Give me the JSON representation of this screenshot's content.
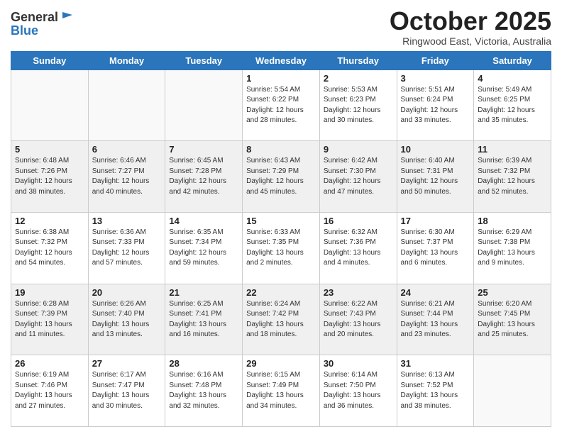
{
  "header": {
    "logo_line1": "General",
    "logo_line2": "Blue",
    "month": "October 2025",
    "location": "Ringwood East, Victoria, Australia"
  },
  "weekdays": [
    "Sunday",
    "Monday",
    "Tuesday",
    "Wednesday",
    "Thursday",
    "Friday",
    "Saturday"
  ],
  "rows": [
    [
      {
        "day": "",
        "info": ""
      },
      {
        "day": "",
        "info": ""
      },
      {
        "day": "",
        "info": ""
      },
      {
        "day": "1",
        "info": "Sunrise: 5:54 AM\nSunset: 6:22 PM\nDaylight: 12 hours\nand 28 minutes."
      },
      {
        "day": "2",
        "info": "Sunrise: 5:53 AM\nSunset: 6:23 PM\nDaylight: 12 hours\nand 30 minutes."
      },
      {
        "day": "3",
        "info": "Sunrise: 5:51 AM\nSunset: 6:24 PM\nDaylight: 12 hours\nand 33 minutes."
      },
      {
        "day": "4",
        "info": "Sunrise: 5:49 AM\nSunset: 6:25 PM\nDaylight: 12 hours\nand 35 minutes."
      }
    ],
    [
      {
        "day": "5",
        "info": "Sunrise: 6:48 AM\nSunset: 7:26 PM\nDaylight: 12 hours\nand 38 minutes."
      },
      {
        "day": "6",
        "info": "Sunrise: 6:46 AM\nSunset: 7:27 PM\nDaylight: 12 hours\nand 40 minutes."
      },
      {
        "day": "7",
        "info": "Sunrise: 6:45 AM\nSunset: 7:28 PM\nDaylight: 12 hours\nand 42 minutes."
      },
      {
        "day": "8",
        "info": "Sunrise: 6:43 AM\nSunset: 7:29 PM\nDaylight: 12 hours\nand 45 minutes."
      },
      {
        "day": "9",
        "info": "Sunrise: 6:42 AM\nSunset: 7:30 PM\nDaylight: 12 hours\nand 47 minutes."
      },
      {
        "day": "10",
        "info": "Sunrise: 6:40 AM\nSunset: 7:31 PM\nDaylight: 12 hours\nand 50 minutes."
      },
      {
        "day": "11",
        "info": "Sunrise: 6:39 AM\nSunset: 7:32 PM\nDaylight: 12 hours\nand 52 minutes."
      }
    ],
    [
      {
        "day": "12",
        "info": "Sunrise: 6:38 AM\nSunset: 7:32 PM\nDaylight: 12 hours\nand 54 minutes."
      },
      {
        "day": "13",
        "info": "Sunrise: 6:36 AM\nSunset: 7:33 PM\nDaylight: 12 hours\nand 57 minutes."
      },
      {
        "day": "14",
        "info": "Sunrise: 6:35 AM\nSunset: 7:34 PM\nDaylight: 12 hours\nand 59 minutes."
      },
      {
        "day": "15",
        "info": "Sunrise: 6:33 AM\nSunset: 7:35 PM\nDaylight: 13 hours\nand 2 minutes."
      },
      {
        "day": "16",
        "info": "Sunrise: 6:32 AM\nSunset: 7:36 PM\nDaylight: 13 hours\nand 4 minutes."
      },
      {
        "day": "17",
        "info": "Sunrise: 6:30 AM\nSunset: 7:37 PM\nDaylight: 13 hours\nand 6 minutes."
      },
      {
        "day": "18",
        "info": "Sunrise: 6:29 AM\nSunset: 7:38 PM\nDaylight: 13 hours\nand 9 minutes."
      }
    ],
    [
      {
        "day": "19",
        "info": "Sunrise: 6:28 AM\nSunset: 7:39 PM\nDaylight: 13 hours\nand 11 minutes."
      },
      {
        "day": "20",
        "info": "Sunrise: 6:26 AM\nSunset: 7:40 PM\nDaylight: 13 hours\nand 13 minutes."
      },
      {
        "day": "21",
        "info": "Sunrise: 6:25 AM\nSunset: 7:41 PM\nDaylight: 13 hours\nand 16 minutes."
      },
      {
        "day": "22",
        "info": "Sunrise: 6:24 AM\nSunset: 7:42 PM\nDaylight: 13 hours\nand 18 minutes."
      },
      {
        "day": "23",
        "info": "Sunrise: 6:22 AM\nSunset: 7:43 PM\nDaylight: 13 hours\nand 20 minutes."
      },
      {
        "day": "24",
        "info": "Sunrise: 6:21 AM\nSunset: 7:44 PM\nDaylight: 13 hours\nand 23 minutes."
      },
      {
        "day": "25",
        "info": "Sunrise: 6:20 AM\nSunset: 7:45 PM\nDaylight: 13 hours\nand 25 minutes."
      }
    ],
    [
      {
        "day": "26",
        "info": "Sunrise: 6:19 AM\nSunset: 7:46 PM\nDaylight: 13 hours\nand 27 minutes."
      },
      {
        "day": "27",
        "info": "Sunrise: 6:17 AM\nSunset: 7:47 PM\nDaylight: 13 hours\nand 30 minutes."
      },
      {
        "day": "28",
        "info": "Sunrise: 6:16 AM\nSunset: 7:48 PM\nDaylight: 13 hours\nand 32 minutes."
      },
      {
        "day": "29",
        "info": "Sunrise: 6:15 AM\nSunset: 7:49 PM\nDaylight: 13 hours\nand 34 minutes."
      },
      {
        "day": "30",
        "info": "Sunrise: 6:14 AM\nSunset: 7:50 PM\nDaylight: 13 hours\nand 36 minutes."
      },
      {
        "day": "31",
        "info": "Sunrise: 6:13 AM\nSunset: 7:52 PM\nDaylight: 13 hours\nand 38 minutes."
      },
      {
        "day": "",
        "info": ""
      }
    ]
  ]
}
